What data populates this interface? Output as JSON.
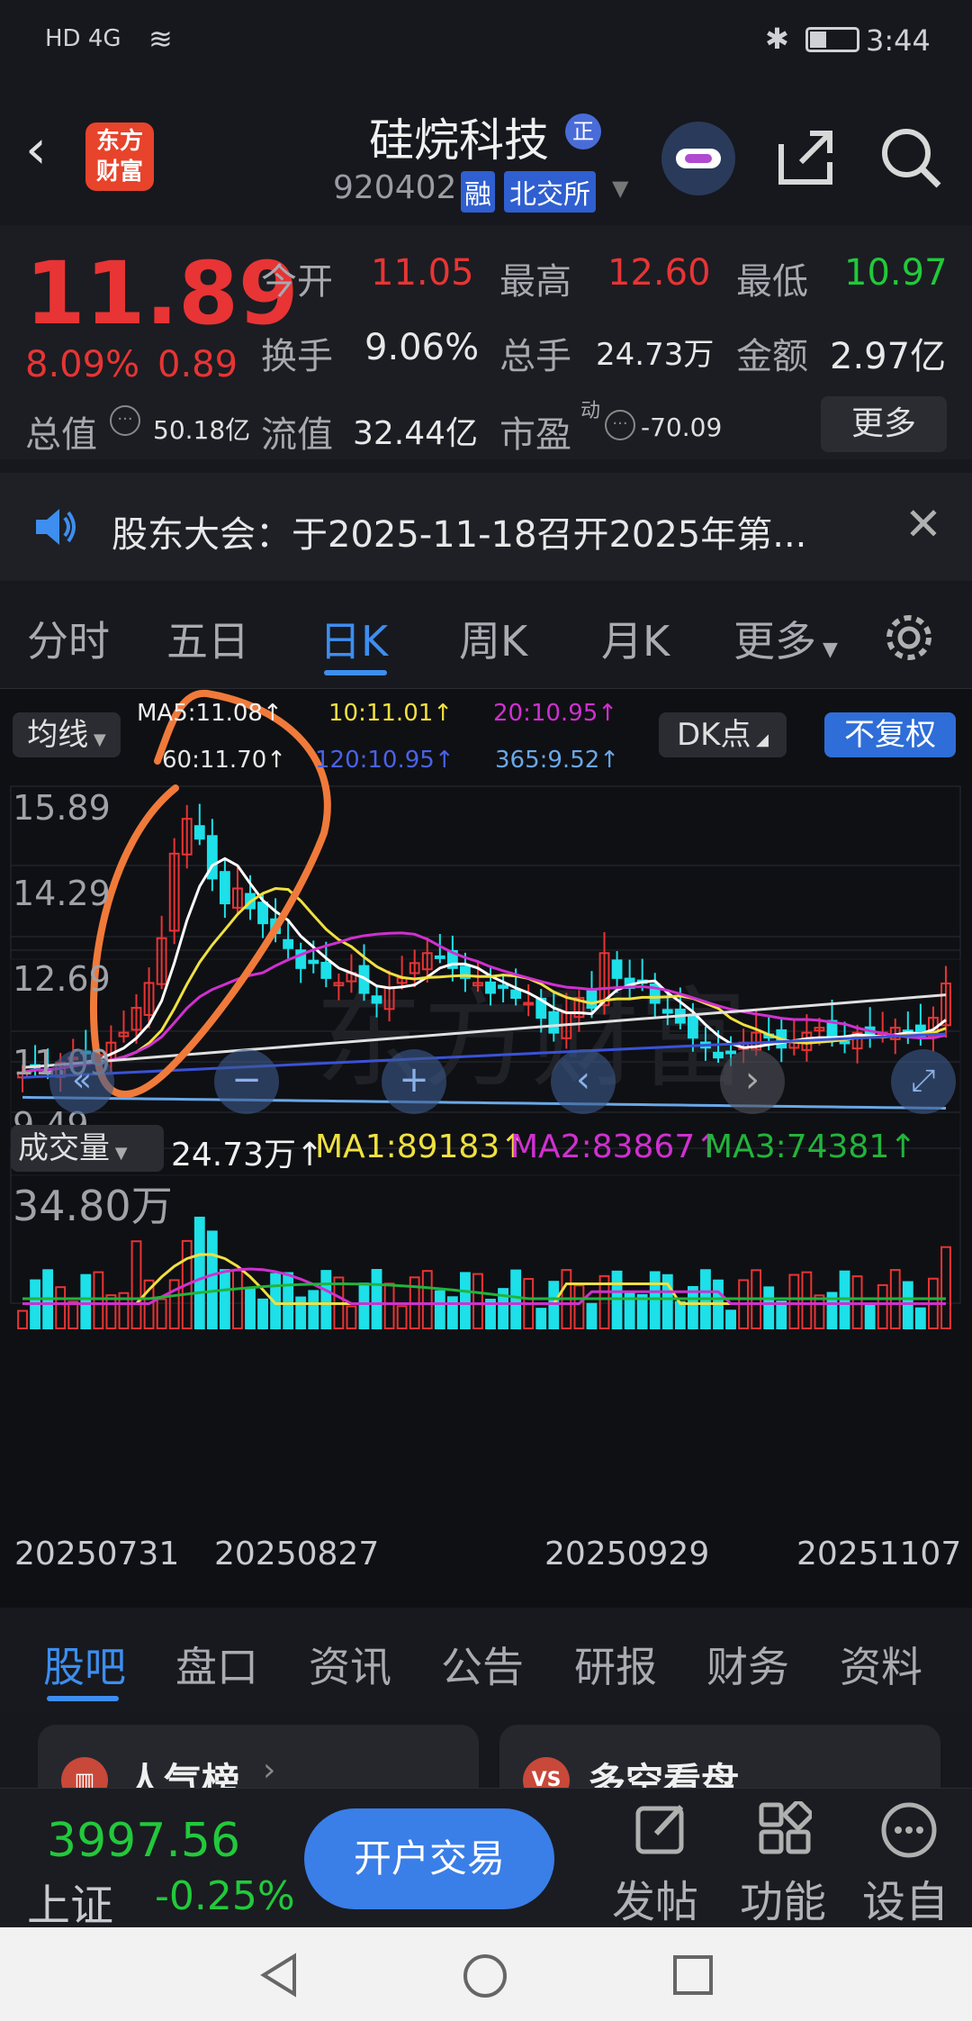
{
  "status": {
    "signal": "HD 4G",
    "time": "3:44"
  },
  "header": {
    "logo_text_1": "东方",
    "logo_text_2": "财富",
    "stock_name": "硅烷科技",
    "badge": "正",
    "code": "920402",
    "tag_margin": "融",
    "exchange": "北交所"
  },
  "quote": {
    "price": "11.89",
    "change_pct": "8.09%",
    "change_amt": "0.89",
    "open_label": "今开",
    "open": "11.05",
    "high_label": "最高",
    "high": "12.60",
    "low_label": "最低",
    "low": "10.97",
    "turnover_label": "换手",
    "turnover": "9.06%",
    "volume_label": "总手",
    "volume": "24.73万",
    "amount_label": "金额",
    "amount": "2.97亿",
    "mktcap_label": "总值",
    "mktcap": "50.18亿",
    "float_label": "流值",
    "float": "32.44亿",
    "pe_label": "市盈",
    "pe_sup": "动",
    "pe": "-70.09",
    "more_label": "更多"
  },
  "notice": {
    "text": "股东大会：于2025-11-18召开2025年第..."
  },
  "tabs": [
    "分时",
    "五日",
    "日K",
    "周K",
    "月K",
    "更多"
  ],
  "active_tab": 2,
  "chart": {
    "ma_button": "均线",
    "dk_button": "DK点",
    "fq_button": "不复权",
    "ma5": "MA5:11.08↑",
    "ma10": "10:11.01↑",
    "ma20": "20:10.95↑",
    "ma60": "60:11.70↑",
    "ma120": "120:10.95↑",
    "ma365": "365:9.52↑",
    "y_labels": [
      "15.89",
      "14.29",
      "12.69",
      "11.09",
      "9.49"
    ],
    "vol_button": "成交量",
    "vol_value": "24.73万↑",
    "vol_ma1": "MA1:89183↑",
    "vol_ma2": "MA2:83867↑",
    "vol_ma3": "MA3:74381↑",
    "vol_max": "34.80万",
    "x_labels": [
      "20250731",
      "20250827",
      "20250929",
      "20251107"
    ],
    "watermark": "东方财富",
    "colors": {
      "up": "#e83434",
      "down": "#1de0e8",
      "ma5": "#ffffff",
      "ma10": "#f0e040",
      "ma20": "#d030d0",
      "ma60": "#e0e0e0",
      "ma120": "#3a52d8",
      "ma365": "#6aa8e8"
    }
  },
  "bottom_tabs": [
    "股吧",
    "盘口",
    "资讯",
    "公告",
    "研报",
    "财务",
    "资料"
  ],
  "cards": [
    {
      "title": "人气榜",
      "icon": "chart-icon"
    },
    {
      "title": "多空看盘",
      "icon": "vs-icon"
    }
  ],
  "footer": {
    "index_value": "3997.56",
    "index_name": "上证",
    "index_change": "-0.25%",
    "trade_button": "开户交易",
    "post_label": "发帖",
    "func_label": "功能",
    "self_label": "设自"
  }
}
